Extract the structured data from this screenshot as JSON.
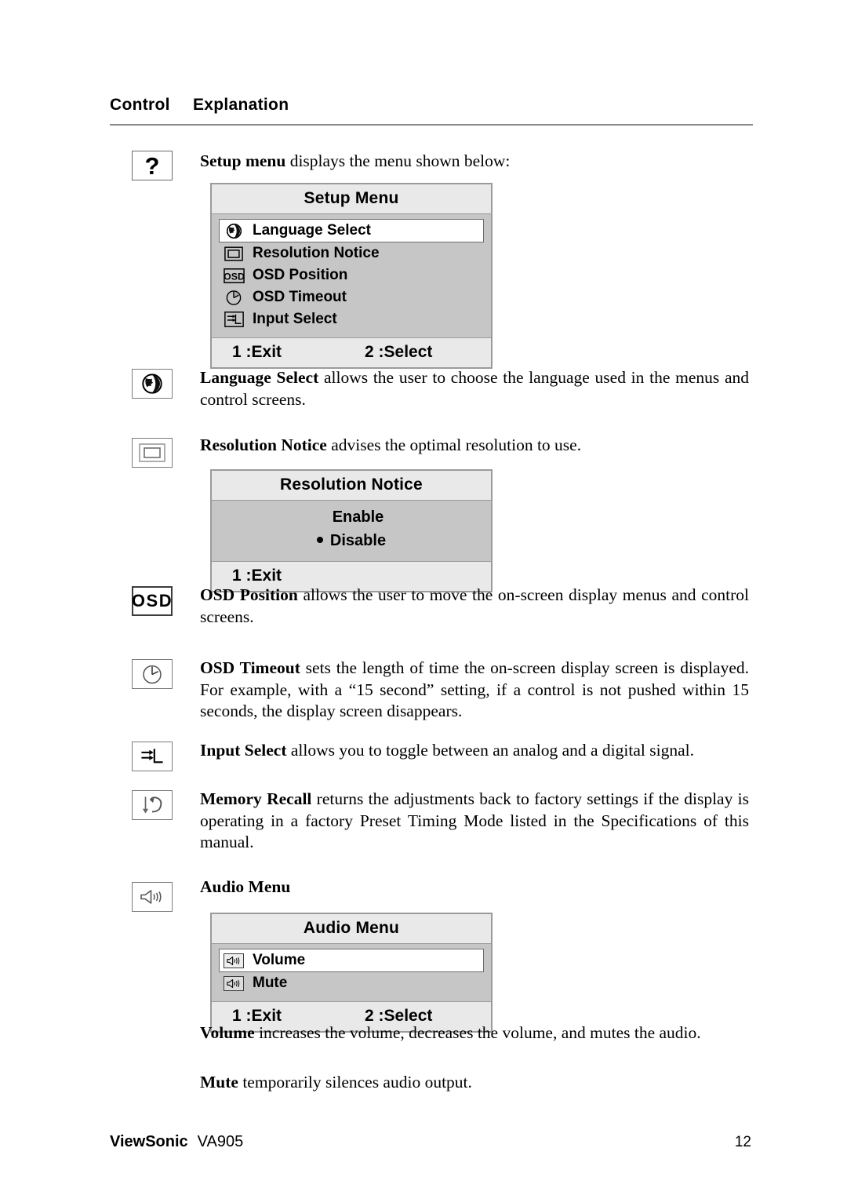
{
  "header": {
    "control_label": "Control",
    "explanation_label": "Explanation"
  },
  "sections": {
    "setup": {
      "icon_name": "question-mark-icon",
      "icon_glyph": "?",
      "lead": "Setup menu",
      "text": " displays the menu shown below:"
    },
    "language": {
      "icon_name": "globe-icon",
      "lead": "Language Select",
      "text": " allows the user to choose the language used in the menus and control screens."
    },
    "resolution": {
      "icon_name": "screen-icon",
      "lead": "Resolution Notice",
      "text": " advises the optimal resolution to use."
    },
    "osd_position": {
      "icon_name": "osd-text-icon",
      "icon_glyph": "OSD",
      "lead": "OSD Position",
      "text": " allows the user to move the on-screen display menus and control screens."
    },
    "osd_timeout": {
      "icon_name": "clock-icon",
      "lead": "OSD Timeout",
      "text": " sets the length of time the on-screen display screen is displayed. For example, with a “15 second” setting, if a control is not pushed within 15 seconds, the display screen disappears."
    },
    "input_select": {
      "icon_name": "input-select-icon",
      "lead": "Input Select",
      "text": " allows you to toggle between an analog and a digital signal."
    },
    "memory_recall": {
      "icon_name": "memory-recall-icon",
      "lead": "Memory Recall",
      "text": " returns the adjustments back to factory settings if the display is operating in a factory Preset Timing Mode listed in the Specifications of this manual."
    },
    "audio": {
      "icon_name": "speaker-icon",
      "heading": "Audio Menu"
    },
    "volume": {
      "lead": "Volume",
      "text": " increases the volume, decreases the volume, and mutes the audio."
    },
    "mute": {
      "lead": "Mute",
      "text": " temporarily silences audio output."
    }
  },
  "osd_setup_menu": {
    "title": "Setup Menu",
    "items": [
      {
        "label": "Language Select",
        "icon": "globe-icon",
        "selected": true
      },
      {
        "label": "Resolution Notice",
        "icon": "screen-icon",
        "selected": false
      },
      {
        "label": "OSD Position",
        "icon": "osd-text-icon",
        "selected": false
      },
      {
        "label": "OSD Timeout",
        "icon": "clock-icon",
        "selected": false
      },
      {
        "label": "Input Select",
        "icon": "input-select-icon",
        "selected": false
      }
    ],
    "footer_left": "1 :Exit",
    "footer_right": "2 :Select"
  },
  "osd_resolution_notice": {
    "title": "Resolution Notice",
    "options": [
      {
        "label": "Enable",
        "selected": false
      },
      {
        "label": "Disable",
        "selected": true
      }
    ],
    "footer_left": "1 :Exit"
  },
  "osd_audio_menu": {
    "title": "Audio Menu",
    "items": [
      {
        "label": "Volume",
        "icon": "speaker-icon",
        "selected": true
      },
      {
        "label": "Mute",
        "icon": "speaker-icon",
        "selected": false
      }
    ],
    "footer_left": "1 :Exit",
    "footer_right": "2 :Select"
  },
  "footer": {
    "brand": "ViewSonic",
    "model": "VA905",
    "page_number": "12"
  },
  "colors": {
    "osd_title_bg": "#e9e9e9",
    "osd_body_bg": "#c6c6c6",
    "osd_selected_bg": "#ffffff",
    "osd_border": "#9b9b9b",
    "rule": "#8a8a8a",
    "text": "#000000"
  }
}
